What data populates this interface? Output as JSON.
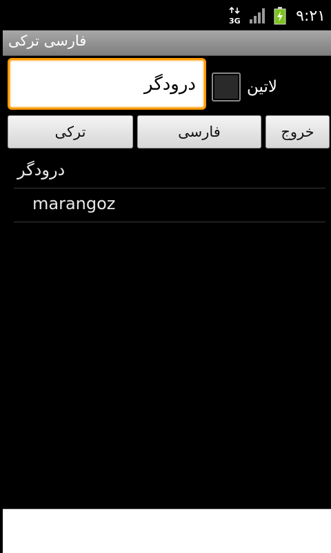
{
  "status_bar": {
    "network": "3G",
    "time": "۹:۲۱"
  },
  "title_bar": {
    "title": "فارسی ترکی"
  },
  "search": {
    "value": "درودگر"
  },
  "latin": {
    "label": "لاتین",
    "checked": false
  },
  "buttons": {
    "turkish": "ترکی",
    "persian": "فارسی",
    "exit": "خروج"
  },
  "results": [
    {
      "text": "درودگر"
    },
    {
      "text": "marangoz"
    }
  ],
  "colors": {
    "focus_border": "#ff9a00",
    "title_bar": "#8e8e8e",
    "battery": "#7cc31d"
  }
}
